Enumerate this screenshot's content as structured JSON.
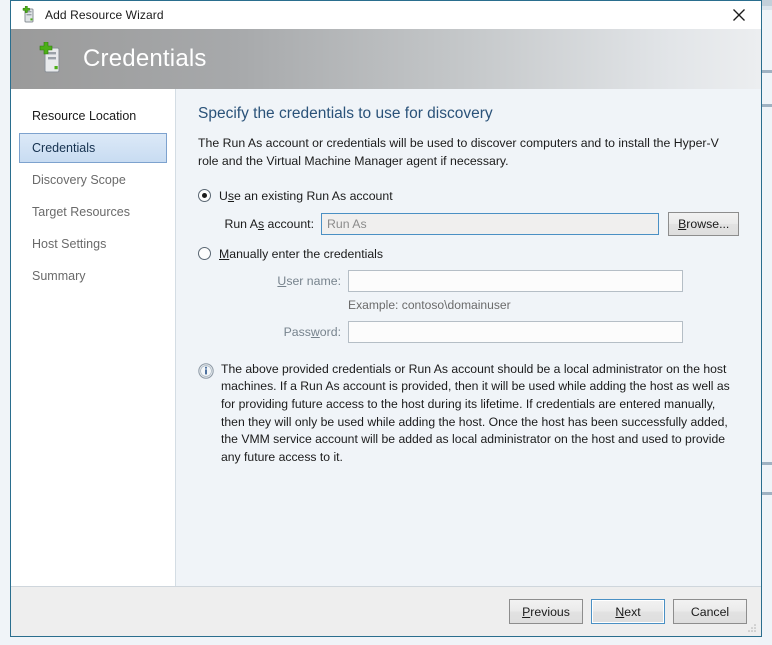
{
  "window": {
    "title": "Add Resource Wizard",
    "title_icon": "add-server-icon",
    "close_icon": "close-icon"
  },
  "banner": {
    "title": "Credentials",
    "icon": "add-server-icon"
  },
  "sidebar": {
    "items": [
      {
        "label": "Resource Location",
        "state": "done"
      },
      {
        "label": "Credentials",
        "state": "active"
      },
      {
        "label": "Discovery Scope",
        "state": "pending"
      },
      {
        "label": "Target Resources",
        "state": "pending"
      },
      {
        "label": "Host Settings",
        "state": "pending"
      },
      {
        "label": "Summary",
        "state": "pending"
      }
    ]
  },
  "content": {
    "heading": "Specify the credentials to use for discovery",
    "description": "The Run As account or credentials will be used to discover computers and to install the Hyper-V role and the Virtual Machine Manager agent if necessary.",
    "option_existing": {
      "label_pre": "U",
      "label_acc": "s",
      "label_post": "e an existing Run As account",
      "selected": true
    },
    "runas": {
      "label_pre": "Run A",
      "label_acc": "s",
      "label_post": " account:",
      "value": "",
      "placeholder": "Run As",
      "browse_label_pre": "",
      "browse_label_acc": "B",
      "browse_label_post": "rowse..."
    },
    "option_manual": {
      "label_pre": "",
      "label_acc": "M",
      "label_post": "anually enter the credentials",
      "selected": false
    },
    "username": {
      "label_pre": "",
      "label_acc": "U",
      "label_post": "ser name:",
      "value": "",
      "hint": "Example: contoso\\domainuser"
    },
    "password": {
      "label_pre": "Pass",
      "label_acc": "w",
      "label_post": "ord:",
      "value": ""
    },
    "info": {
      "icon": "info-icon",
      "text": "The above provided credentials or Run As account should be a local administrator on the host machines. If a Run As account is provided, then it will be used while adding the host as well as for providing future access to the host during its lifetime. If credentials are entered manually, then they will only be used while adding the host. Once the host has been successfully added, the VMM service account will be added as local administrator on the host and used to provide any future access to it."
    }
  },
  "footer": {
    "previous": {
      "pre": "P",
      "acc": "r",
      "post": "evious"
    },
    "next": {
      "pre": "N",
      "acc": "e",
      "post": "xt",
      "focused": true
    },
    "cancel": {
      "pre": "",
      "acc": "",
      "post": "Cancel"
    }
  },
  "colors": {
    "accent_blue": "#2a5279",
    "border_blue": "#2a6e8e",
    "focus_blue": "#4a90c4",
    "icon_green": "#4caf17"
  }
}
